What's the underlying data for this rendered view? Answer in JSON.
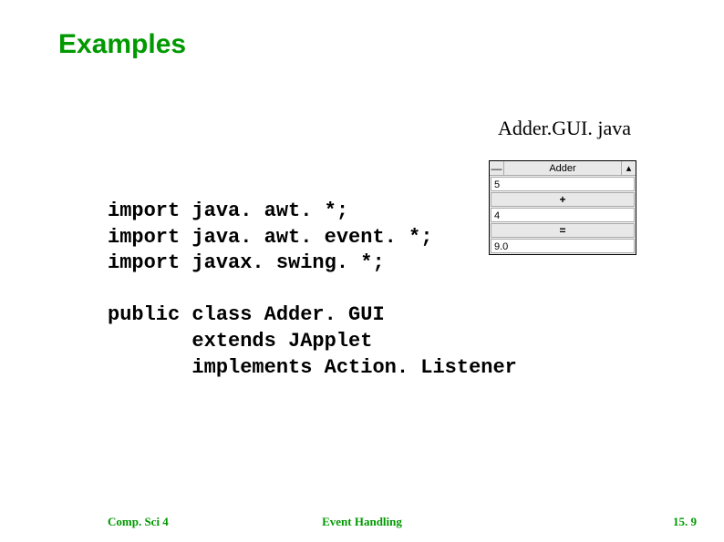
{
  "title": "Examples",
  "filename": "Adder.GUI. java",
  "code": "import java. awt. *;\nimport java. awt. event. *;\nimport javax. swing. *;\n\npublic class Adder. GUI\n       extends JApplet\n       implements Action. Listener",
  "applet": {
    "title": "Adder",
    "sysbox": "—",
    "winbtn": "▴",
    "field1": "5",
    "plusBtn": "+",
    "field2": "4",
    "eqBtn": "=",
    "field3": "9.0"
  },
  "footer": {
    "left": "Comp. Sci 4",
    "center": "Event Handling",
    "right": "15. 9"
  }
}
